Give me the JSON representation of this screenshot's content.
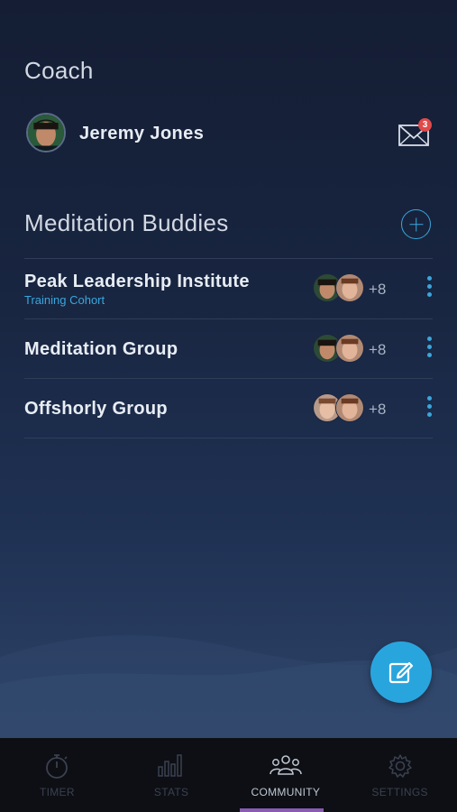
{
  "coach": {
    "title": "Coach",
    "name": "Jeremy Jones",
    "unread_count": "3"
  },
  "buddies": {
    "title": "Meditation Buddies",
    "groups": [
      {
        "name": "Peak Leadership Institute",
        "subtitle": "Training Cohort",
        "extra_members": "+8"
      },
      {
        "name": "Meditation Group",
        "subtitle": "",
        "extra_members": "+8"
      },
      {
        "name": "Offshorly Group",
        "subtitle": "",
        "extra_members": "+8"
      }
    ]
  },
  "tabs": [
    {
      "label": "TIMER",
      "icon": "stopwatch-icon",
      "active": false
    },
    {
      "label": "STATS",
      "icon": "bar-chart-icon",
      "active": false
    },
    {
      "label": "COMMUNITY",
      "icon": "people-icon",
      "active": true
    },
    {
      "label": "SETTINGS",
      "icon": "gear-icon",
      "active": false
    }
  ],
  "colors": {
    "accent": "#3aa6dc",
    "fab": "#29a5de",
    "badge": "#e24a4a",
    "active_tab_indicator": "#8a5bb3"
  }
}
